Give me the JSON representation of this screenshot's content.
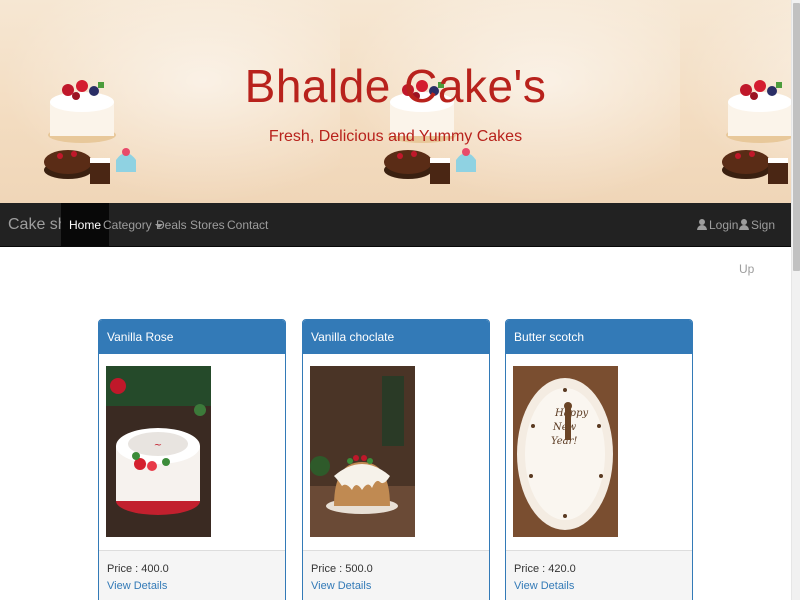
{
  "banner": {
    "title": "Bhalde Cake's",
    "subtitle": "Fresh, Delicious and Yummy Cakes"
  },
  "navbar": {
    "brand": "Cake shop",
    "items": [
      {
        "label": "Home",
        "active": true
      },
      {
        "label": "Category",
        "dropdown": true
      },
      {
        "label": "Deals"
      },
      {
        "label": "Stores"
      },
      {
        "label": "Contact"
      }
    ],
    "right": [
      {
        "label": "Login",
        "icon": "user-icon"
      },
      {
        "label": "Sign Up",
        "icon": "user-icon"
      }
    ]
  },
  "products": [
    {
      "name": "Vanilla Rose",
      "price": "Price : 400.0",
      "link": "View Details"
    },
    {
      "name": "Vanilla choclate",
      "price": "Price : 500.0",
      "link": "View Details"
    },
    {
      "name": "Butter scotch",
      "price": "Price : 420.0",
      "link": "View Details"
    }
  ],
  "colors": {
    "navbar_bg": "#222222",
    "panel_primary": "#337ab7",
    "banner_text": "#b8221c"
  }
}
